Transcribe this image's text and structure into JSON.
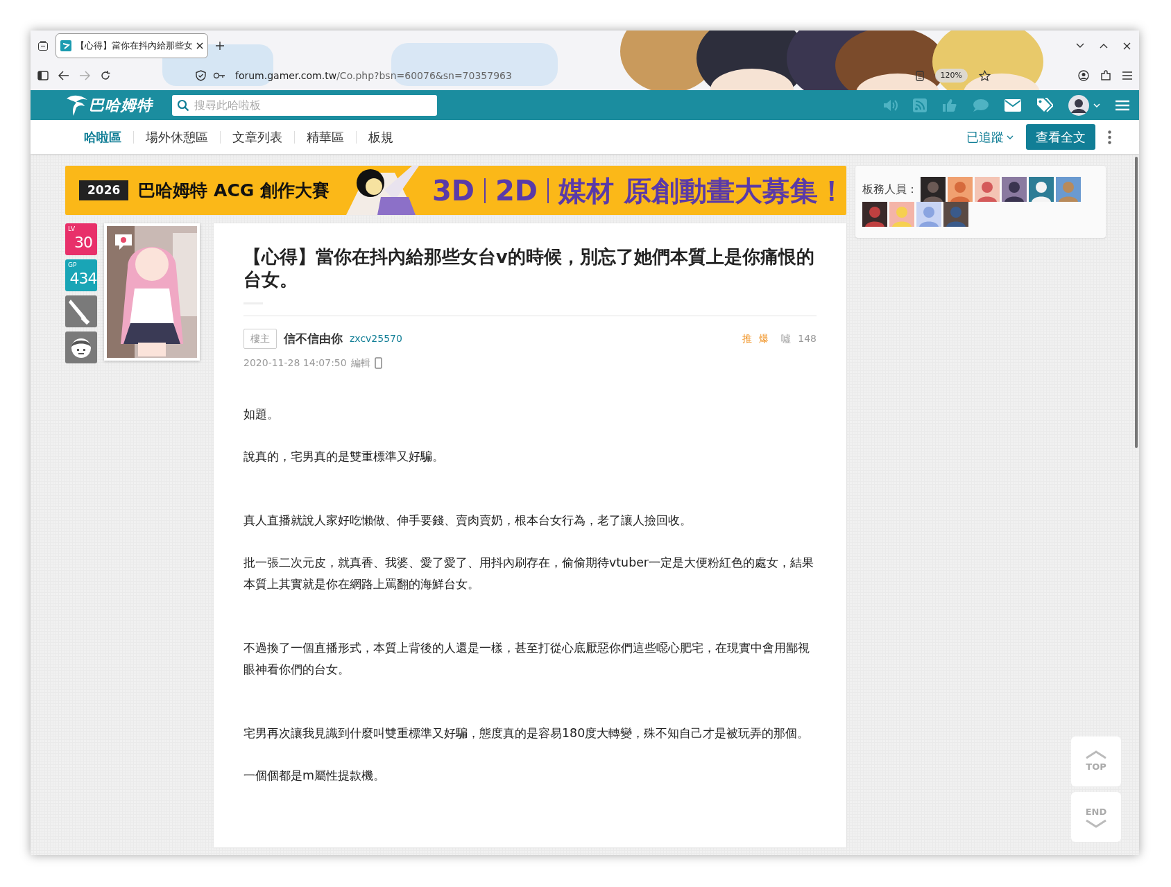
{
  "browser": {
    "tab_title": "【心得】當你在抖內給那些女",
    "url_host": "forum.gamer.com.tw",
    "url_path": "/Co.php?bsn=60076&sn=70357963",
    "zoom": "120%"
  },
  "site_header": {
    "logo": "巴哈姆特",
    "search_placeholder": "搜尋此哈啦板"
  },
  "board_nav": {
    "items": [
      {
        "label": "哈啦區",
        "selected": true
      },
      {
        "label": "場外休憩區",
        "selected": false
      },
      {
        "label": "文章列表",
        "selected": false
      },
      {
        "label": "精華區",
        "selected": false
      },
      {
        "label": "板規",
        "selected": false
      }
    ],
    "follow": "已追蹤",
    "view_all": "查看全文"
  },
  "banner": {
    "year": "2026",
    "title": "巴哈姆特 ACG 創作大賽",
    "parts": [
      "3D",
      "2D",
      "媒材 原創動畫大募集！"
    ]
  },
  "author_badges": [
    {
      "kind": "level",
      "caption": "LV",
      "value": "30",
      "color": "#e8306a"
    },
    {
      "kind": "level",
      "caption": "GP",
      "value": "434",
      "color": "#19a5b6"
    },
    {
      "kind": "knife"
    },
    {
      "kind": "face"
    }
  ],
  "post": {
    "title": "【心得】當你在抖內給那些女台v的時候，別忘了她們本質上是你痛恨的台女。",
    "floor_tag": "樓主",
    "author_name": "信不信由你",
    "author_id": "zxcv25570",
    "push_label": "推",
    "push_count": "爆",
    "boo_label": "噓",
    "boo_count": "148",
    "timestamp": "2020-11-28 14:07:50",
    "edit": "編輯",
    "sections": [
      {
        "paragraphs": [
          "如題。",
          "說真的，宅男真的是雙重標準又好騙。"
        ]
      },
      {
        "paragraphs": [
          "真人直播就說人家好吃懶做、伸手要錢、賣肉賣奶，根本台女行為，老了讓人撿回收。",
          "批一張二次元皮，就真香、我婆、愛了愛了、用抖內刷存在，偷偷期待vtuber一定是大便粉紅色的處女，結果本質上其實就是你在網路上罵翻的海鮮台女。"
        ]
      },
      {
        "paragraphs": [
          "不過換了一個直播形式，本質上背後的人還是一樣，甚至打從心底厭惡你們這些噁心肥宅，在現實中會用鄙視眼神看你們的台女。"
        ]
      },
      {
        "paragraphs": [
          "宅男再次讓我見識到什麼叫雙重標準又好騙，態度真的是容易180度大轉變，殊不知自己才是被玩弄的那個。",
          "一個個都是m屬性提款機。"
        ]
      }
    ]
  },
  "moderators": {
    "label": "板務人員：",
    "avatars": [
      {
        "kind": "avatar"
      },
      {
        "kind": "avatar"
      },
      {
        "kind": "avatar"
      },
      {
        "kind": "avatar"
      },
      {
        "kind": "avatar"
      },
      {
        "kind": "avatar"
      },
      {
        "kind": "avatar"
      },
      {
        "kind": "avatar"
      },
      {
        "kind": "avatar"
      },
      {
        "kind": "avatar"
      }
    ]
  },
  "scroll_buttons": [
    {
      "kind": "top",
      "label": "TOP"
    },
    {
      "kind": "end",
      "label": "END"
    }
  ]
}
